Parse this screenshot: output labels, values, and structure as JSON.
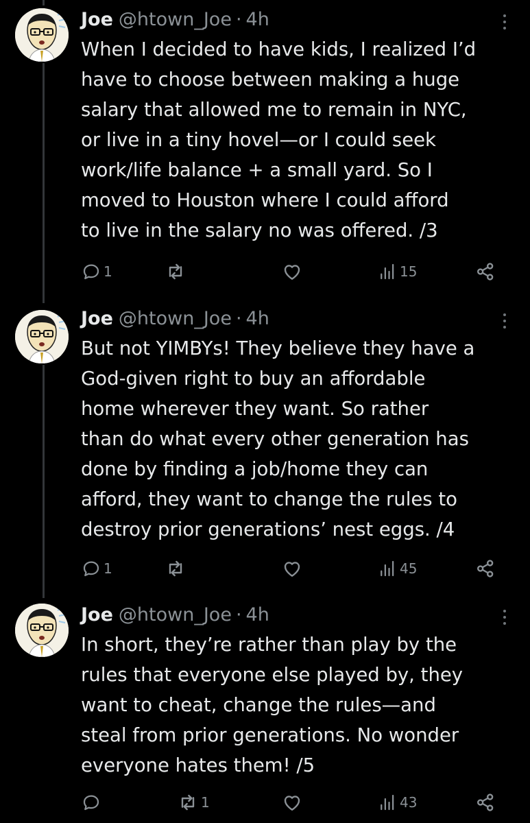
{
  "colors": {
    "background": "#000000",
    "text": "#e7e9ea",
    "muted": "#8b9196",
    "thread_line": "#333639"
  },
  "tweets": [
    {
      "name": "Joe",
      "handle": "@htown_Joe",
      "separator": "·",
      "time": "4h",
      "lines": [
        "When I decided to have kids, I realized I’d",
        "have to choose between making a huge",
        "salary that allowed me to remain in NYC,",
        "or live in a tiny hovel—or I could seek",
        "work/life balance + a small yard. So I",
        "moved to Houston where I could afford",
        "to live in the salary no was offered. /3"
      ],
      "replies": "1",
      "retweets": "",
      "likes": "",
      "views": "15"
    },
    {
      "name": "Joe",
      "handle": "@htown_Joe",
      "separator": "·",
      "time": "4h",
      "lines": [
        "But not YIMBYs! They believe they have a",
        "God-given right to buy an affordable",
        "home wherever they want. So rather",
        "than do what every other generation has",
        "done by finding a job/home they can",
        "afford, they want to change the rules to",
        "destroy prior generations’ nest eggs. /4"
      ],
      "replies": "1",
      "retweets": "",
      "likes": "",
      "views": "45"
    },
    {
      "name": "Joe",
      "handle": "@htown_Joe",
      "separator": "·",
      "time": "4h",
      "lines": [
        "In short, they’re rather than play by the",
        "rules that everyone else played by, they",
        "want to cheat, change the rules—and",
        "steal from prior generations. No wonder",
        "everyone hates them! /5"
      ],
      "replies": "",
      "retweets": "1",
      "likes": "",
      "views": "43"
    }
  ],
  "icons": {
    "reply": "reply-icon",
    "retweet": "retweet-icon",
    "like": "heart-icon",
    "views": "views-icon",
    "share": "share-icon",
    "more": "more-options-icon"
  }
}
